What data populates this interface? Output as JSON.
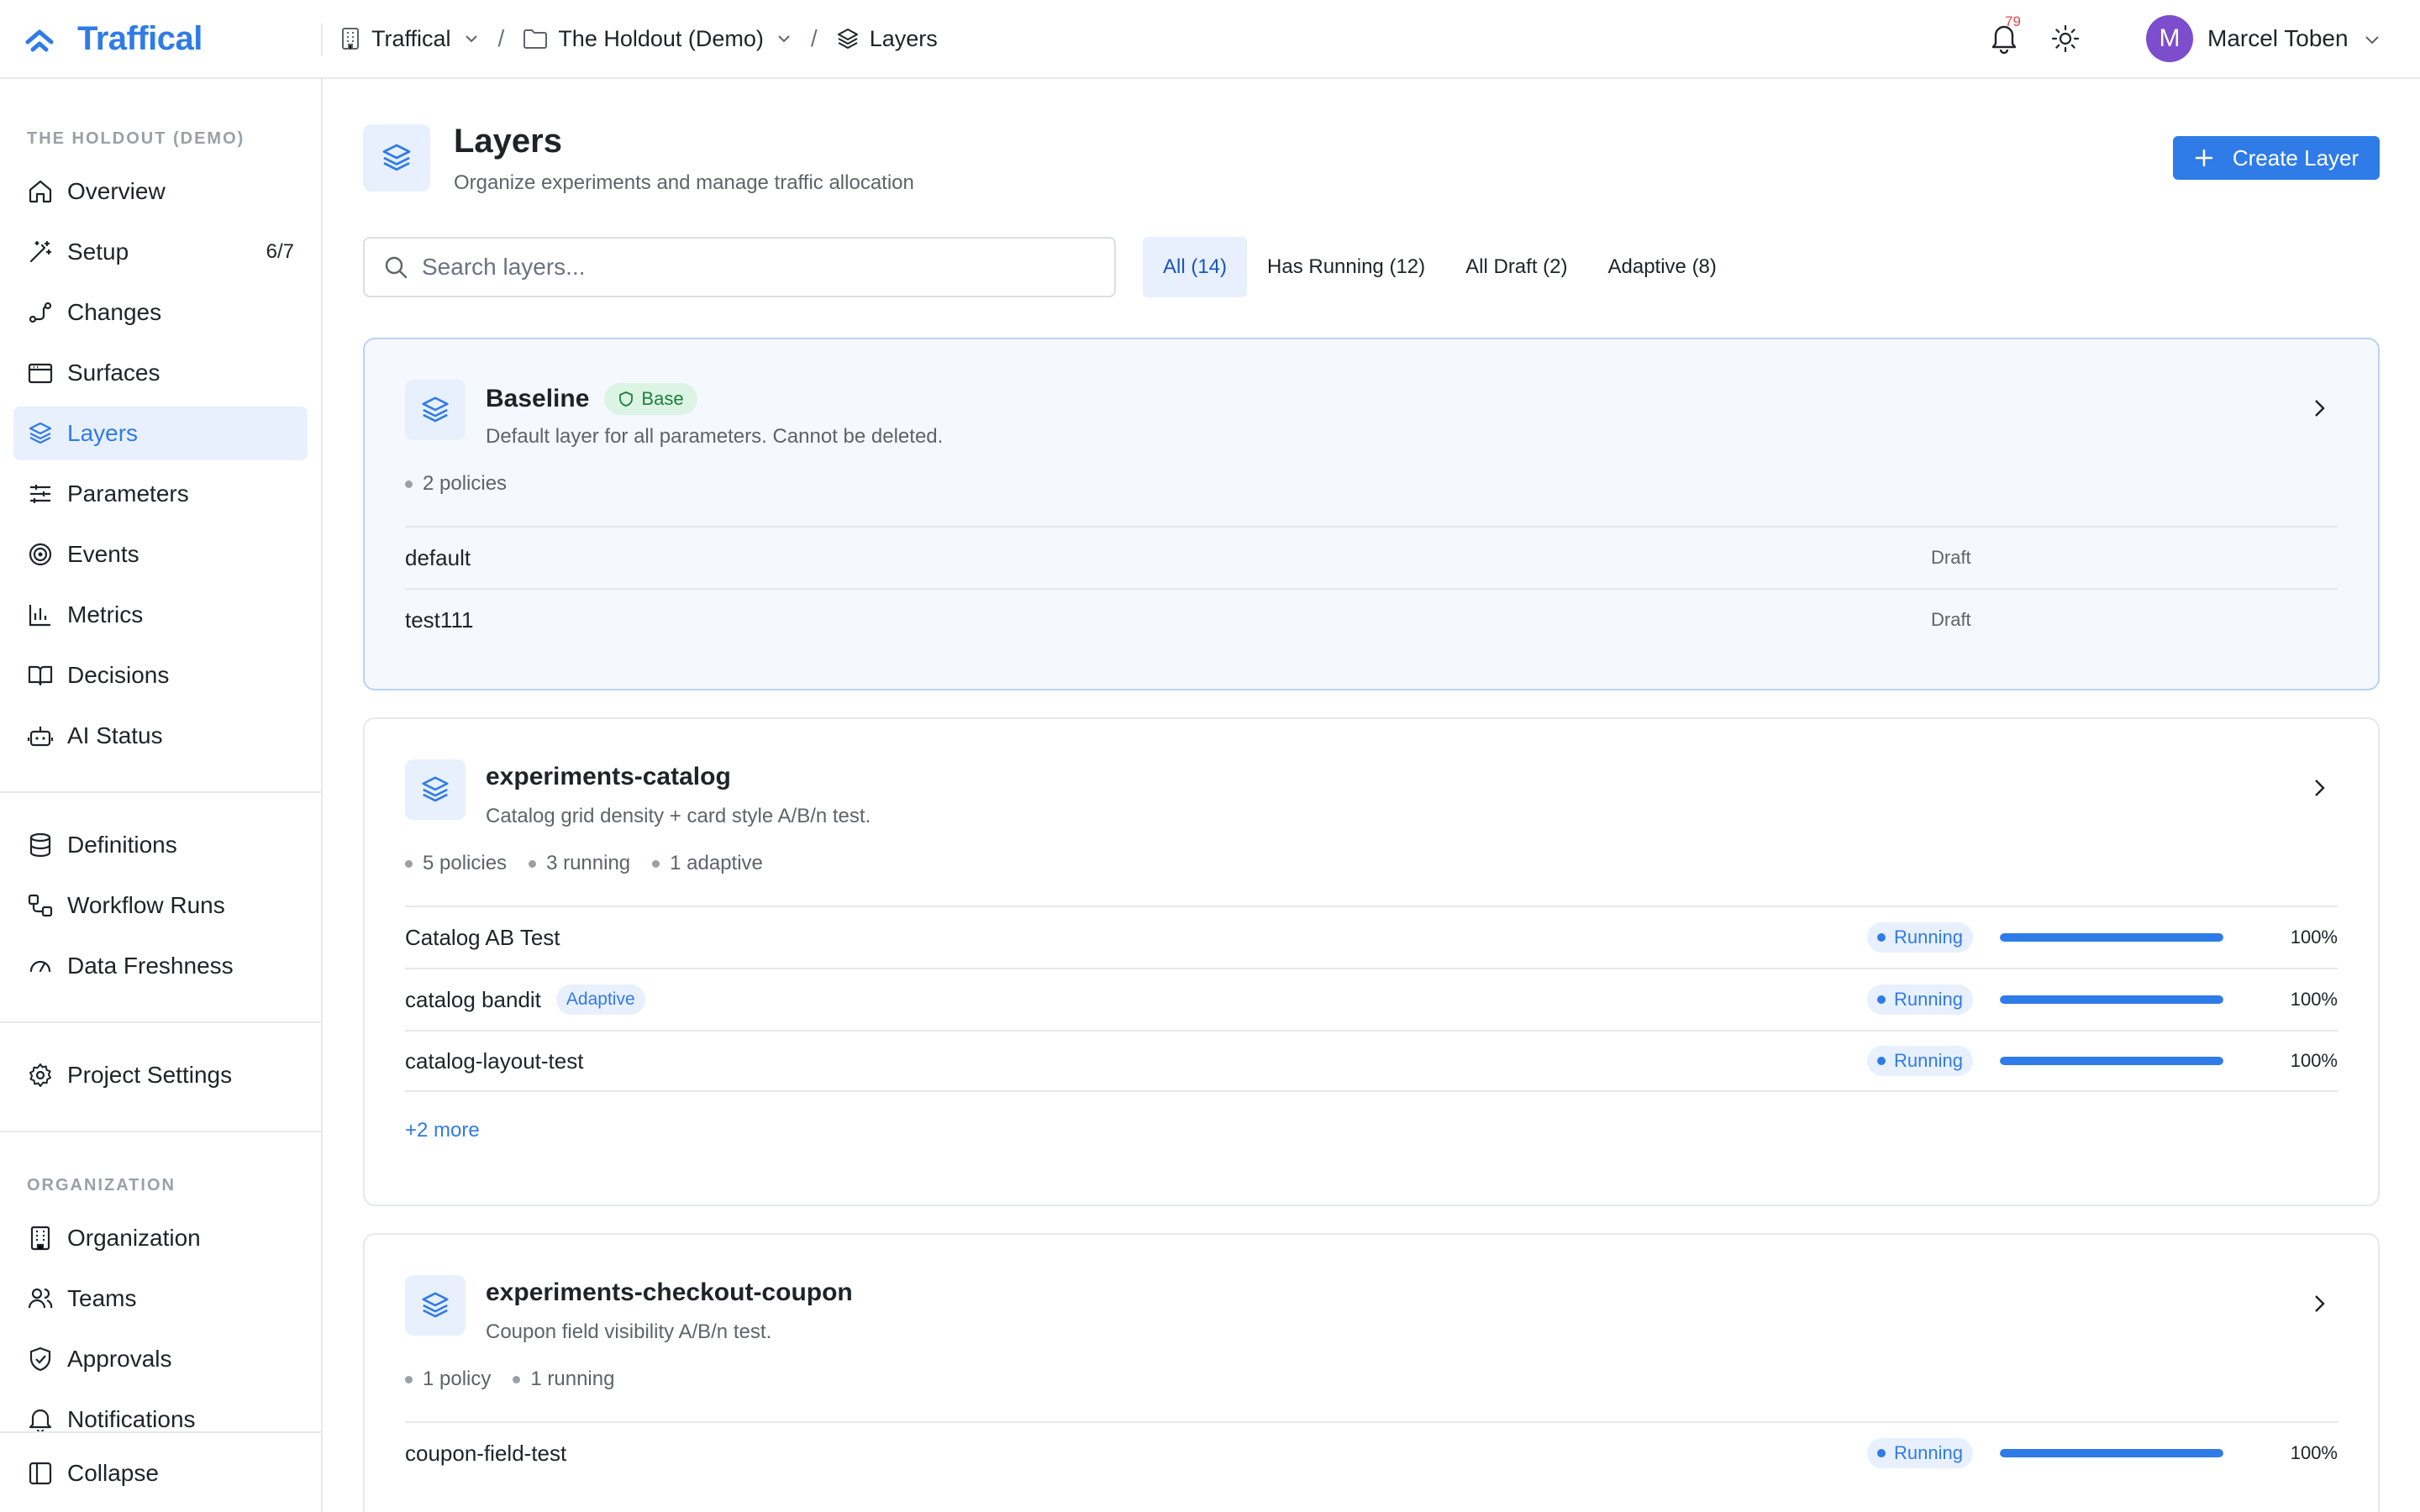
{
  "app": {
    "name": "Traffical"
  },
  "breadcrumbs": [
    {
      "label": "Traffical"
    },
    {
      "label": "The Holdout (Demo)"
    },
    {
      "label": "Layers"
    }
  ],
  "header": {
    "notification_count": "79",
    "user_initial": "M",
    "user_name": "Marcel Toben"
  },
  "sidebar": {
    "project_heading": "THE HOLDOUT (DEMO)",
    "items": [
      {
        "label": "Overview",
        "icon": "home-icon"
      },
      {
        "label": "Setup",
        "icon": "wand-icon",
        "count": "6/7"
      },
      {
        "label": "Changes",
        "icon": "changes-icon"
      },
      {
        "label": "Surfaces",
        "icon": "browser-icon"
      },
      {
        "label": "Layers",
        "icon": "layers-icon",
        "active": true
      },
      {
        "label": "Parameters",
        "icon": "sliders-icon"
      },
      {
        "label": "Events",
        "icon": "target-icon"
      },
      {
        "label": "Metrics",
        "icon": "bar-chart-icon"
      },
      {
        "label": "Decisions",
        "icon": "book-icon"
      },
      {
        "label": "AI Status",
        "icon": "bot-icon"
      }
    ],
    "secondary_items": [
      {
        "label": "Definitions",
        "icon": "database-icon"
      },
      {
        "label": "Workflow Runs",
        "icon": "workflow-icon"
      },
      {
        "label": "Data Freshness",
        "icon": "gauge-icon"
      }
    ],
    "settings_item": {
      "label": "Project Settings",
      "icon": "gear-icon"
    },
    "org_heading": "ORGANIZATION",
    "org_items": [
      {
        "label": "Organization",
        "icon": "building-icon"
      },
      {
        "label": "Teams",
        "icon": "users-icon"
      },
      {
        "label": "Approvals",
        "icon": "shield-check-icon"
      },
      {
        "label": "Notifications",
        "icon": "bell-icon"
      }
    ],
    "collapse_label": "Collapse"
  },
  "page": {
    "title": "Layers",
    "subtitle": "Organize experiments and manage traffic allocation",
    "create_button": "Create Layer",
    "search_placeholder": "Search layers...",
    "filters": [
      {
        "label": "All (14)",
        "active": true
      },
      {
        "label": "Has Running (12)"
      },
      {
        "label": "All Draft (2)"
      },
      {
        "label": "Adaptive (8)"
      }
    ]
  },
  "layers": [
    {
      "name": "Baseline",
      "badge": "Base",
      "description": "Default layer for all parameters. Cannot be deleted.",
      "stats": [
        "2 policies"
      ],
      "policies": [
        {
          "name": "default",
          "status": "Draft"
        },
        {
          "name": "test111",
          "status": "Draft"
        }
      ]
    },
    {
      "name": "experiments-catalog",
      "description": "Catalog grid density + card style A/B/n test.",
      "stats": [
        "5 policies",
        "3 running",
        "1 adaptive"
      ],
      "policies": [
        {
          "name": "Catalog AB Test",
          "status": "Running",
          "allocation": 100,
          "allocation_label": "100%"
        },
        {
          "name": "catalog bandit",
          "tag": "Adaptive",
          "status": "Running",
          "allocation": 100,
          "allocation_label": "100%"
        },
        {
          "name": "catalog-layout-test",
          "status": "Running",
          "allocation": 100,
          "allocation_label": "100%"
        }
      ],
      "more": "+2 more"
    },
    {
      "name": "experiments-checkout-coupon",
      "description": "Coupon field visibility A/B/n test.",
      "stats": [
        "1 policy",
        "1 running"
      ],
      "policies": [
        {
          "name": "coupon-field-test",
          "status": "Running",
          "allocation": 100,
          "allocation_label": "100%"
        }
      ]
    }
  ]
}
